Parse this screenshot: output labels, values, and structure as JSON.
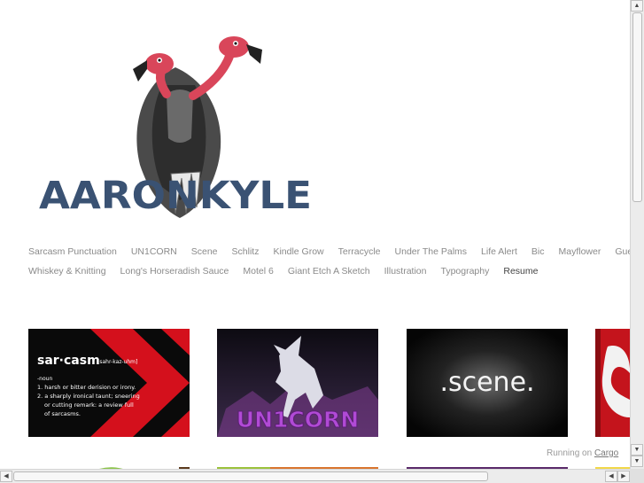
{
  "logo": {
    "text": "AARONKYLE"
  },
  "nav": {
    "row1": [
      "Sarcasm Punctuation",
      "UN1CORN",
      "Scene",
      "Schlitz",
      "Kindle Grow",
      "Terracycle",
      "Under The Palms",
      "Life Alert",
      "Bic",
      "Mayflower",
      "Guess"
    ],
    "row2": [
      "Whiskey & Knitting",
      "Long's Horseradish Sauce",
      "Motel 6",
      "Giant Etch A Sketch",
      "Illustration",
      "Typography",
      "Resume"
    ],
    "active": "Resume"
  },
  "thumbs": {
    "sarcasm": {
      "word": "sar·casm",
      "pron": "[sahr-kaz-uhm]",
      "pos": "-noun",
      "lines": [
        "1. harsh or bitter derision or irony.",
        "2. a sharply ironical taunt; sneering",
        "or cutting remark: a review full",
        "of sarcasms."
      ]
    },
    "unicorn": {
      "text": "UN1CORN"
    },
    "scene": {
      "text": ".scene."
    }
  },
  "footer": {
    "running_prefix": "Running on",
    "running_link": "Cargo"
  },
  "colors": {
    "nav_text": "#8a8a8a",
    "logo_blue": "#3a5273",
    "vulture_red": "#d9465a",
    "sarcasm_red": "#d4101c"
  }
}
